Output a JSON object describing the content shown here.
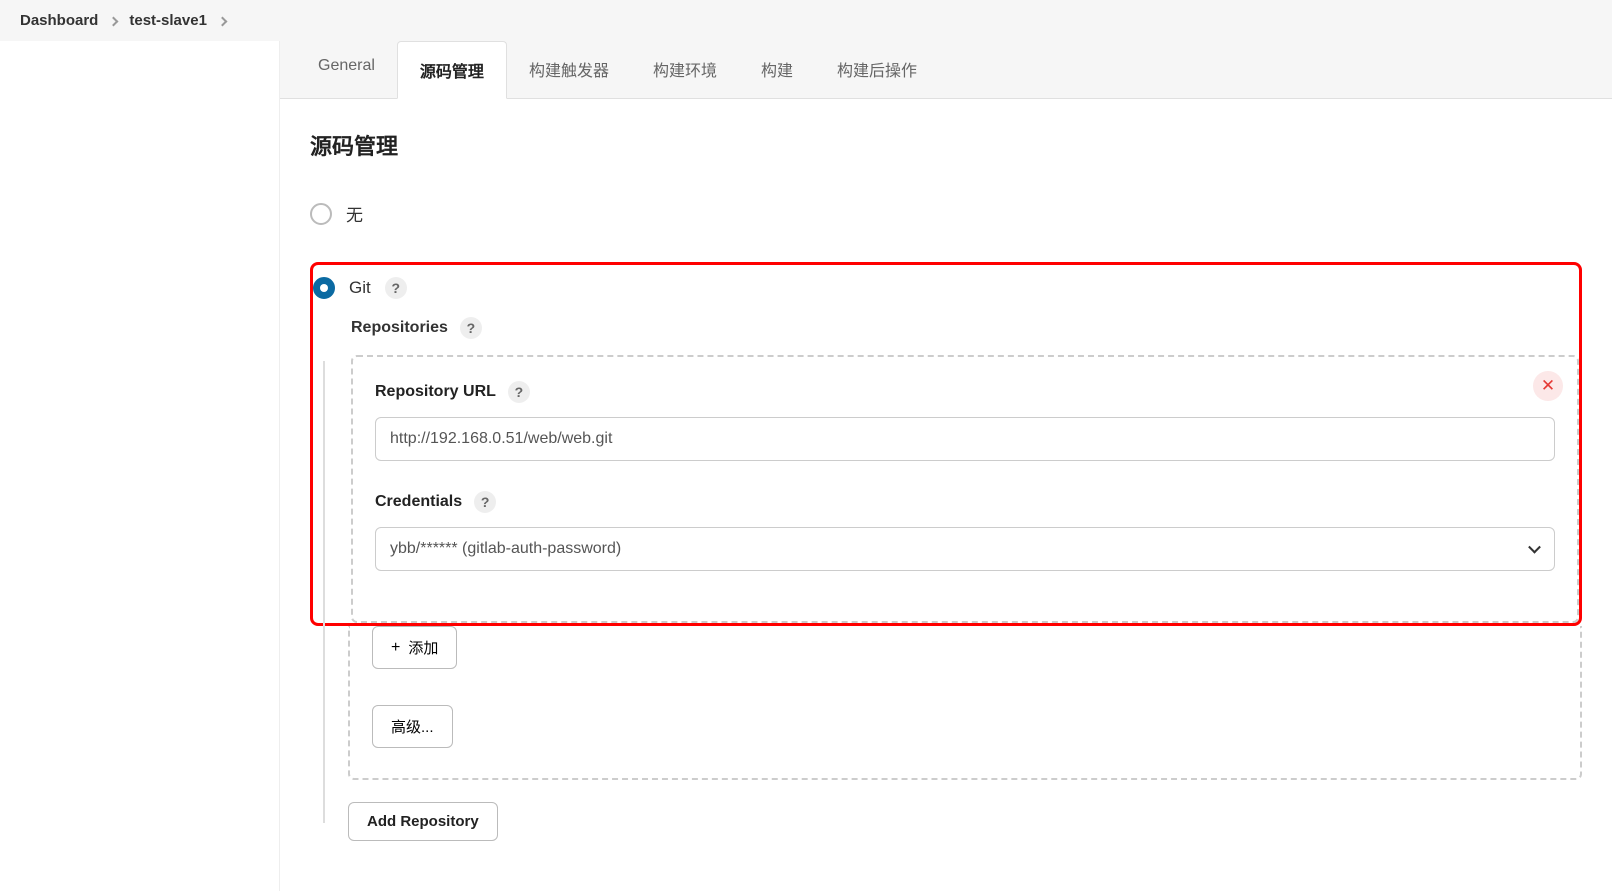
{
  "breadcrumb": {
    "dashboard": "Dashboard",
    "item": "test-slave1"
  },
  "tabs": {
    "general": "General",
    "scm": "源码管理",
    "triggers": "构建触发器",
    "env": "构建环境",
    "build": "构建",
    "post": "构建后操作"
  },
  "section_title": "源码管理",
  "scm_options": {
    "none": "无",
    "git": "Git"
  },
  "git": {
    "repositories_label": "Repositories",
    "repo_url_label": "Repository URL",
    "repo_url_value": "http://192.168.0.51/web/web.git",
    "credentials_label": "Credentials",
    "credentials_value": "ybb/****** (gitlab-auth-password)",
    "add_btn": "添加",
    "advanced_btn": "高级...",
    "add_repo_btn": "Add Repository"
  },
  "help_glyph": "?"
}
